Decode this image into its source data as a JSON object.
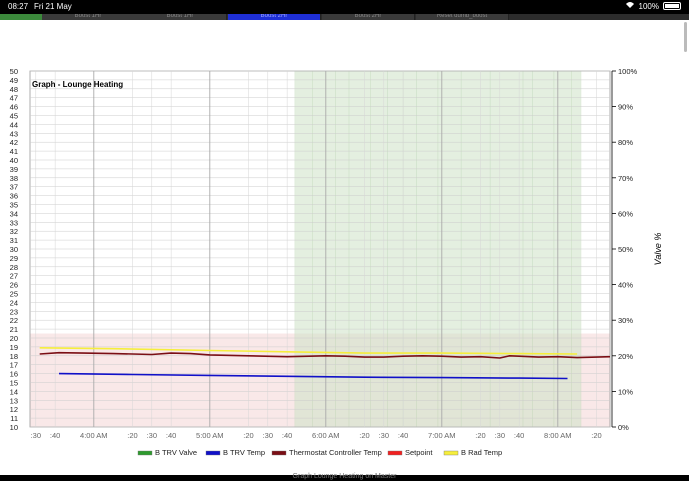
{
  "status_bar": {
    "time": "08:27",
    "date": "Fri 21 May",
    "battery": "100%"
  },
  "tabs": [
    {
      "label": "",
      "state": "first"
    },
    {
      "label": "Boost 1Hr",
      "state": "normal"
    },
    {
      "label": "Boost 1Hr",
      "state": "normal"
    },
    {
      "label": "Boost 2Hr",
      "state": "active"
    },
    {
      "label": "Boost 2Hr",
      "state": "normal"
    },
    {
      "label": "Reset dumb_boost",
      "state": "normal"
    }
  ],
  "bottom_caption": "Graph Lounge Heating on Master",
  "chart_data": {
    "type": "line",
    "title": "Graph - Lounge Heating",
    "ylabel_right": "Valve %",
    "ylim": [
      10,
      50
    ],
    "y_ticks": [
      "10",
      "11",
      "12",
      "13",
      "14",
      "15",
      "16",
      "17",
      "18",
      "19",
      "20",
      "21",
      "22",
      "23",
      "24",
      "25",
      "26",
      "27",
      "28",
      "29",
      "30",
      "31",
      "32",
      "33",
      "34",
      "35",
      "36",
      "37",
      "38",
      "39",
      "40",
      "41",
      "42",
      "43",
      "44",
      "45",
      "46",
      "47",
      "48",
      "49",
      "50"
    ],
    "y2lim": [
      0,
      100
    ],
    "y2_ticks": [
      "0%",
      "10%",
      "20%",
      "30%",
      "40%",
      "50%",
      "60%",
      "70%",
      "80%",
      "90%",
      "100%"
    ],
    "x_ticks": [
      ":30",
      ":40",
      "4:00 AM",
      ":20",
      ":30",
      ":40",
      "5:00 AM",
      ":20",
      ":30",
      ":40",
      "6:00 AM",
      ":20",
      ":30",
      ":40",
      "7:00 AM",
      ":20",
      ":30",
      ":40",
      "8:00 AM",
      ":20"
    ],
    "x_tick_minutes": [
      210,
      220,
      240,
      260,
      270,
      280,
      300,
      320,
      330,
      340,
      360,
      380,
      390,
      400,
      420,
      440,
      450,
      460,
      480,
      500
    ],
    "x_range_minutes": [
      207,
      507
    ],
    "x_ticks_legend_note": "minutes after midnight used only as x values",
    "setpoint_band": {
      "from": 10,
      "to": 20.5
    },
    "trv_valve_open_spans": [
      [
        344,
        353
      ],
      [
        353,
        365
      ],
      [
        365,
        372
      ],
      [
        372,
        383
      ],
      [
        383,
        392
      ],
      [
        392,
        400
      ],
      [
        400,
        407
      ],
      [
        407,
        418
      ],
      [
        418,
        430
      ],
      [
        430,
        445
      ],
      [
        445,
        462
      ],
      [
        462,
        467
      ],
      [
        467,
        478
      ],
      [
        478,
        487
      ],
      [
        487,
        492
      ]
    ],
    "series": [
      {
        "name": "B TRV Temp",
        "color": "#1010c8",
        "x": [
          222,
          260,
          300,
          340,
          380,
          420,
          460,
          485
        ],
        "y": [
          16.0,
          15.9,
          15.8,
          15.7,
          15.6,
          15.55,
          15.5,
          15.45
        ]
      },
      {
        "name": "Thermostat Controller Temp",
        "color": "#7a0e14",
        "x": [
          212,
          222,
          235,
          250,
          260,
          270,
          280,
          290,
          300,
          320,
          340,
          360,
          370,
          380,
          390,
          400,
          410,
          420,
          430,
          440,
          450,
          455,
          460,
          470,
          480,
          490,
          500,
          507
        ],
        "y": [
          18.2,
          18.35,
          18.3,
          18.25,
          18.2,
          18.15,
          18.3,
          18.25,
          18.1,
          18.0,
          17.9,
          18.0,
          17.95,
          17.85,
          17.85,
          17.95,
          18.0,
          17.95,
          17.85,
          17.9,
          17.75,
          18.0,
          17.95,
          17.85,
          17.9,
          17.8,
          17.85,
          17.9
        ]
      },
      {
        "name": "B Rad Temp",
        "color": "#f6ee3c",
        "x": [
          212,
          250,
          300,
          340,
          380,
          420,
          460,
          490
        ],
        "y": [
          18.9,
          18.8,
          18.6,
          18.45,
          18.3,
          18.3,
          18.25,
          18.2
        ]
      }
    ],
    "legend": [
      {
        "name": "B TRV Valve",
        "color": "#2d9a2d"
      },
      {
        "name": "B TRV Temp",
        "color": "#1010c8"
      },
      {
        "name": "Thermostat Controller Temp",
        "color": "#7a0e14"
      },
      {
        "name": "Setpoint",
        "color": "#f02020"
      },
      {
        "name": "B Rad Temp",
        "color": "#f6ee3c"
      }
    ],
    "legend_placement": "bottom",
    "grid": true
  }
}
